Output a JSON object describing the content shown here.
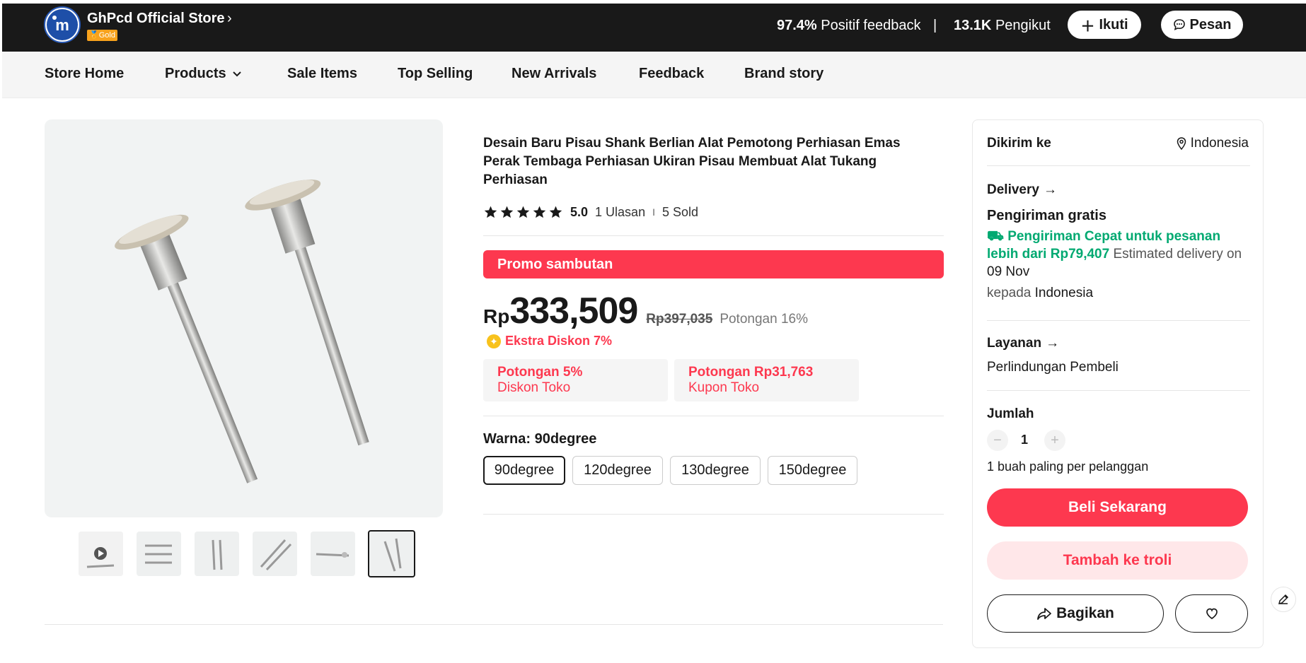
{
  "store": {
    "name": "GhPcd Official Store",
    "badge": "Gold",
    "feedback_pct": "97.4%",
    "feedback_label": "Positif feedback",
    "separator": "|",
    "followers_count": "13.1K",
    "followers_label": "Pengikut",
    "follow_label": "Ikuti",
    "message_label": "Pesan"
  },
  "nav": {
    "items": [
      "Store Home",
      "Products",
      "Sale Items",
      "Top Selling",
      "New Arrivals",
      "Feedback",
      "Brand story"
    ]
  },
  "product": {
    "title": "Desain Baru Pisau Shank Berlian Alat Pemotong Perhiasan Emas Perak Tembaga Perhiasan Ukiran Pisau Membuat Alat Tukang Perhiasan",
    "rating": "5.0",
    "rating_stars": 5,
    "reviews": "1 Ulasan",
    "rating_sep": "I",
    "sold": "5 Sold",
    "promo_banner": "Promo sambutan",
    "price_currency": "Rp",
    "price_value": "333,509",
    "price_original": "Rp397,035",
    "price_discount": "Potongan 16%",
    "extra_discount": "Ekstra Diskon 7%",
    "coupons": [
      {
        "line1": "Potongan 5%",
        "line2": "Diskon Toko"
      },
      {
        "line1": "Potongan Rp31,763",
        "line2": "Kupon Toko"
      }
    ],
    "color_label": "Warna: 90degree",
    "variants": [
      "90degree",
      "120degree",
      "130degree",
      "150degree"
    ],
    "selected_variant": "90degree",
    "thumbnail_count": 6,
    "active_thumbnail": 6
  },
  "panel": {
    "ship_to_label": "Dikirim ke",
    "ship_to_country": "Indonesia",
    "delivery_label": "Delivery",
    "free_shipping": "Pengiriman gratis",
    "fast_shipping": "Pengiriman Cepat untuk pesanan lebih dari Rp79,407",
    "estimated_label": "Estimated delivery on",
    "estimated_date": "09 Nov",
    "to_label": "kepada",
    "to_country": "Indonesia",
    "service_label": "Layanan",
    "service_value": "Perlindungan Pembeli",
    "qty_label": "Jumlah",
    "qty_minus": "−",
    "qty_value": "1",
    "qty_plus": "+",
    "qty_limit": "1 buah paling per pelanggan",
    "buy_now": "Beli Sekarang",
    "add_cart": "Tambah ke troli",
    "share": "Bagikan"
  },
  "colors": {
    "accent_red": "#fd384f",
    "green": "#01a971",
    "dark": "#191919",
    "gold": "#f8a21c"
  }
}
